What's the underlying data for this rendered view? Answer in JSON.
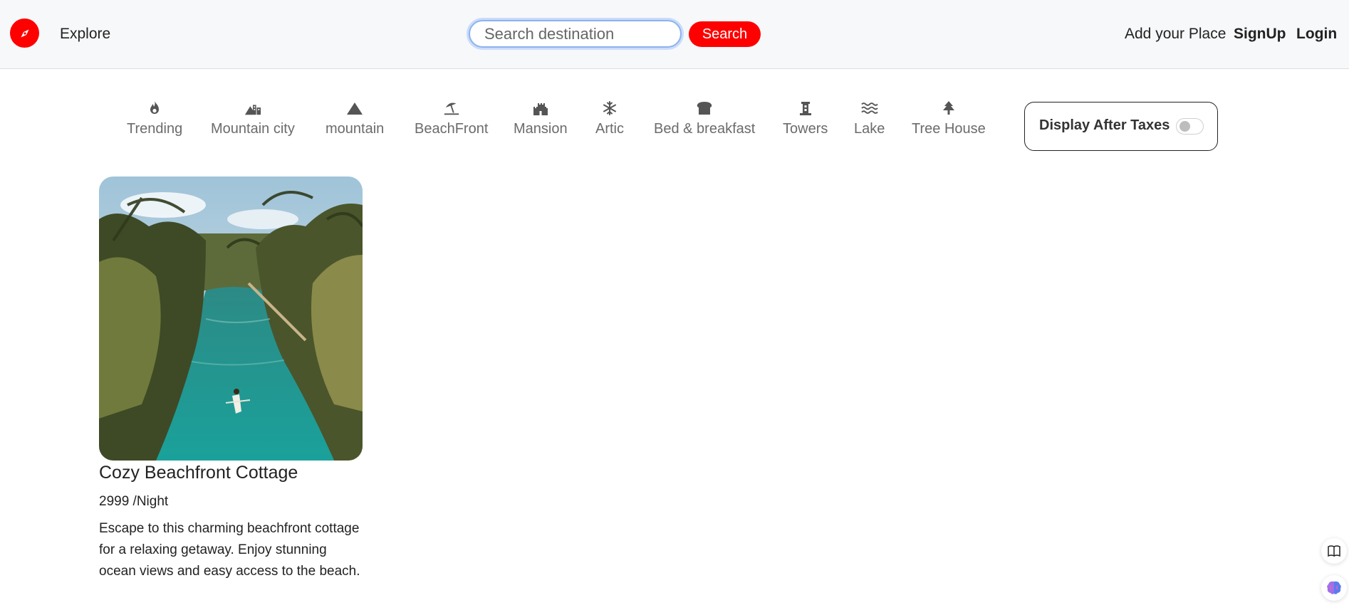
{
  "navbar": {
    "explore_label": "Explore",
    "search_placeholder": "Search destination",
    "search_button": "Search",
    "add_place": "Add your Place",
    "signup": "SignUp",
    "login": "Login"
  },
  "filters": [
    {
      "label": "Trending",
      "icon": "fire-icon"
    },
    {
      "label": "Mountain city",
      "icon": "mountain-city-icon"
    },
    {
      "label": "mountain",
      "icon": "mountain-icon"
    },
    {
      "label": "BeachFront",
      "icon": "umbrella-beach-icon"
    },
    {
      "label": "Mansion",
      "icon": "castle-icon"
    },
    {
      "label": "Artic",
      "icon": "snowflake-icon"
    },
    {
      "label": "Bed & breakfast",
      "icon": "bread-icon"
    },
    {
      "label": "Towers",
      "icon": "tower-icon"
    },
    {
      "label": "Lake",
      "icon": "water-icon"
    },
    {
      "label": "Tree House",
      "icon": "tree-icon"
    }
  ],
  "tax_toggle": {
    "label": "Display After Taxes",
    "enabled": false
  },
  "listing": {
    "title": "Cozy Beachfront Cottage",
    "price": "2999 /Night",
    "description": "Escape to this charming beachfront cottage for a relaxing getaway. Enjoy stunning ocean views and easy access to the beach."
  },
  "colors": {
    "brand": "#fe0000",
    "navbar_bg": "#f7f8fa",
    "muted_text": "#6b6b6b"
  }
}
